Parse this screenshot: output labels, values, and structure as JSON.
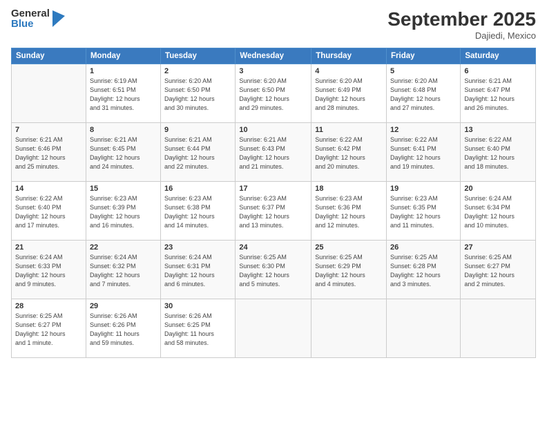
{
  "header": {
    "logo_general": "General",
    "logo_blue": "Blue",
    "month_title": "September 2025",
    "location": "Dajiedi, Mexico"
  },
  "weekdays": [
    "Sunday",
    "Monday",
    "Tuesday",
    "Wednesday",
    "Thursday",
    "Friday",
    "Saturday"
  ],
  "weeks": [
    [
      {
        "day": "",
        "info": ""
      },
      {
        "day": "1",
        "info": "Sunrise: 6:19 AM\nSunset: 6:51 PM\nDaylight: 12 hours\nand 31 minutes."
      },
      {
        "day": "2",
        "info": "Sunrise: 6:20 AM\nSunset: 6:50 PM\nDaylight: 12 hours\nand 30 minutes."
      },
      {
        "day": "3",
        "info": "Sunrise: 6:20 AM\nSunset: 6:50 PM\nDaylight: 12 hours\nand 29 minutes."
      },
      {
        "day": "4",
        "info": "Sunrise: 6:20 AM\nSunset: 6:49 PM\nDaylight: 12 hours\nand 28 minutes."
      },
      {
        "day": "5",
        "info": "Sunrise: 6:20 AM\nSunset: 6:48 PM\nDaylight: 12 hours\nand 27 minutes."
      },
      {
        "day": "6",
        "info": "Sunrise: 6:21 AM\nSunset: 6:47 PM\nDaylight: 12 hours\nand 26 minutes."
      }
    ],
    [
      {
        "day": "7",
        "info": "Sunrise: 6:21 AM\nSunset: 6:46 PM\nDaylight: 12 hours\nand 25 minutes."
      },
      {
        "day": "8",
        "info": "Sunrise: 6:21 AM\nSunset: 6:45 PM\nDaylight: 12 hours\nand 24 minutes."
      },
      {
        "day": "9",
        "info": "Sunrise: 6:21 AM\nSunset: 6:44 PM\nDaylight: 12 hours\nand 22 minutes."
      },
      {
        "day": "10",
        "info": "Sunrise: 6:21 AM\nSunset: 6:43 PM\nDaylight: 12 hours\nand 21 minutes."
      },
      {
        "day": "11",
        "info": "Sunrise: 6:22 AM\nSunset: 6:42 PM\nDaylight: 12 hours\nand 20 minutes."
      },
      {
        "day": "12",
        "info": "Sunrise: 6:22 AM\nSunset: 6:41 PM\nDaylight: 12 hours\nand 19 minutes."
      },
      {
        "day": "13",
        "info": "Sunrise: 6:22 AM\nSunset: 6:40 PM\nDaylight: 12 hours\nand 18 minutes."
      }
    ],
    [
      {
        "day": "14",
        "info": "Sunrise: 6:22 AM\nSunset: 6:40 PM\nDaylight: 12 hours\nand 17 minutes."
      },
      {
        "day": "15",
        "info": "Sunrise: 6:23 AM\nSunset: 6:39 PM\nDaylight: 12 hours\nand 16 minutes."
      },
      {
        "day": "16",
        "info": "Sunrise: 6:23 AM\nSunset: 6:38 PM\nDaylight: 12 hours\nand 14 minutes."
      },
      {
        "day": "17",
        "info": "Sunrise: 6:23 AM\nSunset: 6:37 PM\nDaylight: 12 hours\nand 13 minutes."
      },
      {
        "day": "18",
        "info": "Sunrise: 6:23 AM\nSunset: 6:36 PM\nDaylight: 12 hours\nand 12 minutes."
      },
      {
        "day": "19",
        "info": "Sunrise: 6:23 AM\nSunset: 6:35 PM\nDaylight: 12 hours\nand 11 minutes."
      },
      {
        "day": "20",
        "info": "Sunrise: 6:24 AM\nSunset: 6:34 PM\nDaylight: 12 hours\nand 10 minutes."
      }
    ],
    [
      {
        "day": "21",
        "info": "Sunrise: 6:24 AM\nSunset: 6:33 PM\nDaylight: 12 hours\nand 9 minutes."
      },
      {
        "day": "22",
        "info": "Sunrise: 6:24 AM\nSunset: 6:32 PM\nDaylight: 12 hours\nand 7 minutes."
      },
      {
        "day": "23",
        "info": "Sunrise: 6:24 AM\nSunset: 6:31 PM\nDaylight: 12 hours\nand 6 minutes."
      },
      {
        "day": "24",
        "info": "Sunrise: 6:25 AM\nSunset: 6:30 PM\nDaylight: 12 hours\nand 5 minutes."
      },
      {
        "day": "25",
        "info": "Sunrise: 6:25 AM\nSunset: 6:29 PM\nDaylight: 12 hours\nand 4 minutes."
      },
      {
        "day": "26",
        "info": "Sunrise: 6:25 AM\nSunset: 6:28 PM\nDaylight: 12 hours\nand 3 minutes."
      },
      {
        "day": "27",
        "info": "Sunrise: 6:25 AM\nSunset: 6:27 PM\nDaylight: 12 hours\nand 2 minutes."
      }
    ],
    [
      {
        "day": "28",
        "info": "Sunrise: 6:25 AM\nSunset: 6:27 PM\nDaylight: 12 hours\nand 1 minute."
      },
      {
        "day": "29",
        "info": "Sunrise: 6:26 AM\nSunset: 6:26 PM\nDaylight: 11 hours\nand 59 minutes."
      },
      {
        "day": "30",
        "info": "Sunrise: 6:26 AM\nSunset: 6:25 PM\nDaylight: 11 hours\nand 58 minutes."
      },
      {
        "day": "",
        "info": ""
      },
      {
        "day": "",
        "info": ""
      },
      {
        "day": "",
        "info": ""
      },
      {
        "day": "",
        "info": ""
      }
    ]
  ]
}
